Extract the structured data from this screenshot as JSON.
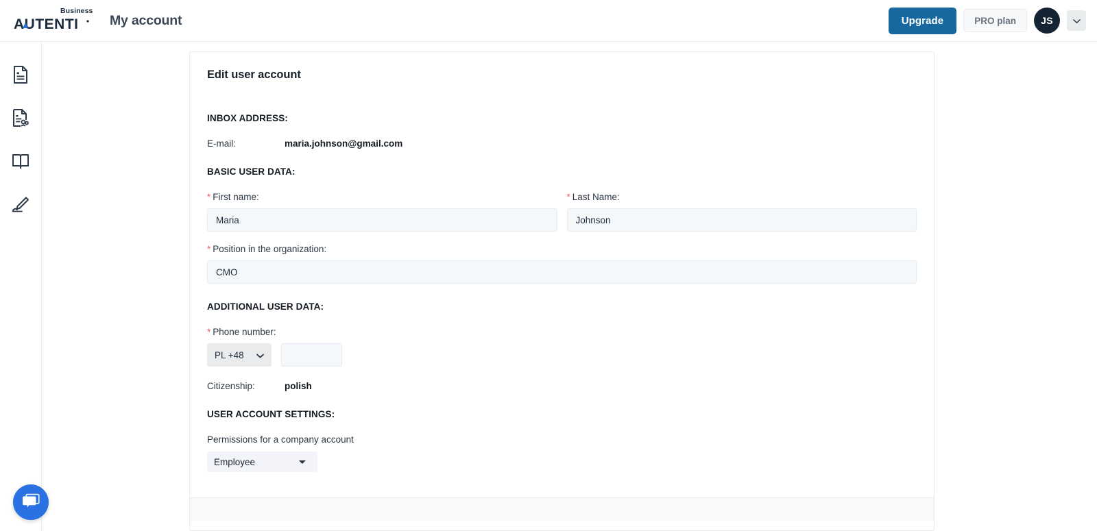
{
  "header": {
    "logo_business": "Business",
    "logo_name": "AUTENTI",
    "page_title": "My account",
    "upgrade_label": "Upgrade",
    "plan_label": "PRO plan",
    "avatar_initials": "JS",
    "caret_icon": "chevron-down-icon",
    "accent_color": "#17689f",
    "avatar_color": "#152433"
  },
  "sidebar": {
    "items": [
      {
        "icon": "document-icon"
      },
      {
        "icon": "document-users-icon"
      },
      {
        "icon": "open-book-icon"
      },
      {
        "icon": "signature-pen-icon"
      }
    ]
  },
  "card": {
    "title": "Edit user account",
    "sections": {
      "inbox": {
        "heading": "INBOX ADDRESS:",
        "email_label": "E-mail:",
        "email_value": "maria.johnson@gmail.com"
      },
      "basic": {
        "heading": "BASIC USER DATA:",
        "first_name_label": "First name:",
        "first_name_value": "Maria",
        "last_name_label": "Last Name:",
        "last_name_value": "Johnson",
        "position_label": "Position in the organization:",
        "position_value": "CMO",
        "required_marker": "*"
      },
      "additional": {
        "heading": "ADDITIONAL USER DATA:",
        "phone_label": "Phone number:",
        "country_code": "PL +48",
        "phone_value": "",
        "phone_placeholder": "",
        "citizenship_label": "Citizenship:",
        "citizenship_value": "polish"
      },
      "settings": {
        "heading": "USER ACCOUNT SETTINGS:",
        "permissions_label": "Permissions for a company account",
        "permissions_value": "Employee",
        "permissions_options": [
          "Employee"
        ]
      }
    }
  },
  "chat": {
    "icon": "chat-bubble-icon",
    "color": "#2a72e4"
  }
}
